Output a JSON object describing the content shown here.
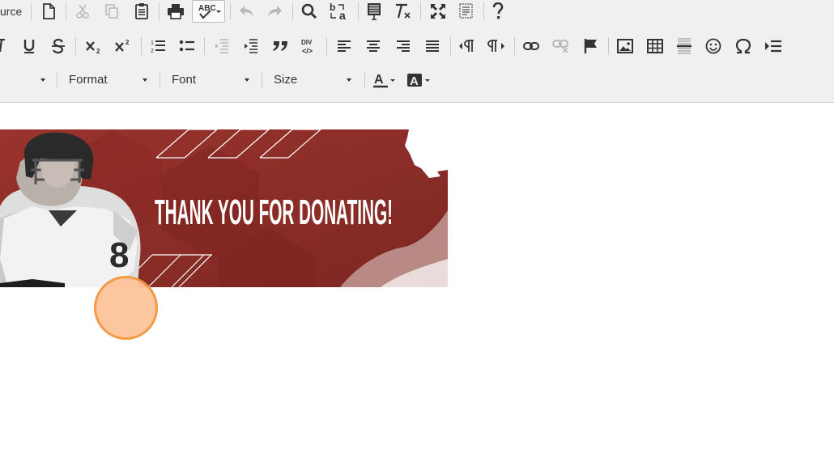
{
  "toolbar": {
    "source_label": "urce",
    "format_label": "Format",
    "font_label": "Font",
    "size_label": "Size",
    "spell_label": "ABC",
    "text_color_label": "A",
    "bg_color_label": "A"
  },
  "banner": {
    "headline": "THANK YOU FOR DONATING!",
    "jersey_number": "8",
    "colors": {
      "bg": "#8e2b26",
      "bg_dark": "#7a2420",
      "text": "#ffffff"
    }
  },
  "colors": {
    "toolbar_bg": "#f0f0f0",
    "icon": "#333333",
    "icon_disabled": "#b8b8b8",
    "marker_fill": "#fcc49a",
    "marker_stroke": "#f3953d"
  }
}
